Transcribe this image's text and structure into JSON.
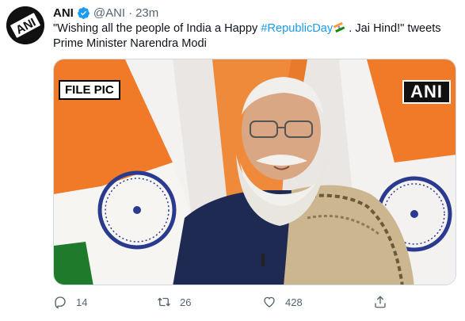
{
  "tweet": {
    "author_name": "ANI",
    "handle": "@ANI",
    "separator": "·",
    "time": "23m",
    "text_before": "\"Wishing all the people of India a Happy ",
    "hashtag": "#RepublicDay",
    "emoji": "🇮🇳",
    "text_after": " . Jai Hind!\" tweets Prime Minister Narendra Modi",
    "media": {
      "overlay_left": "FILE PIC",
      "overlay_right": "ANI"
    },
    "actions": {
      "reply_count": "14",
      "retweet_count": "26",
      "like_count": "428"
    },
    "avatar_text": "ANI"
  },
  "colors": {
    "link": "#1d9bf0",
    "verified": "#1d9bf0",
    "muted": "#536471",
    "saffron": "#ff9933",
    "green": "#138808",
    "chakra": "#000080"
  },
  "icons": [
    "verified-badge-icon",
    "reply-icon",
    "retweet-icon",
    "like-icon",
    "share-icon"
  ]
}
